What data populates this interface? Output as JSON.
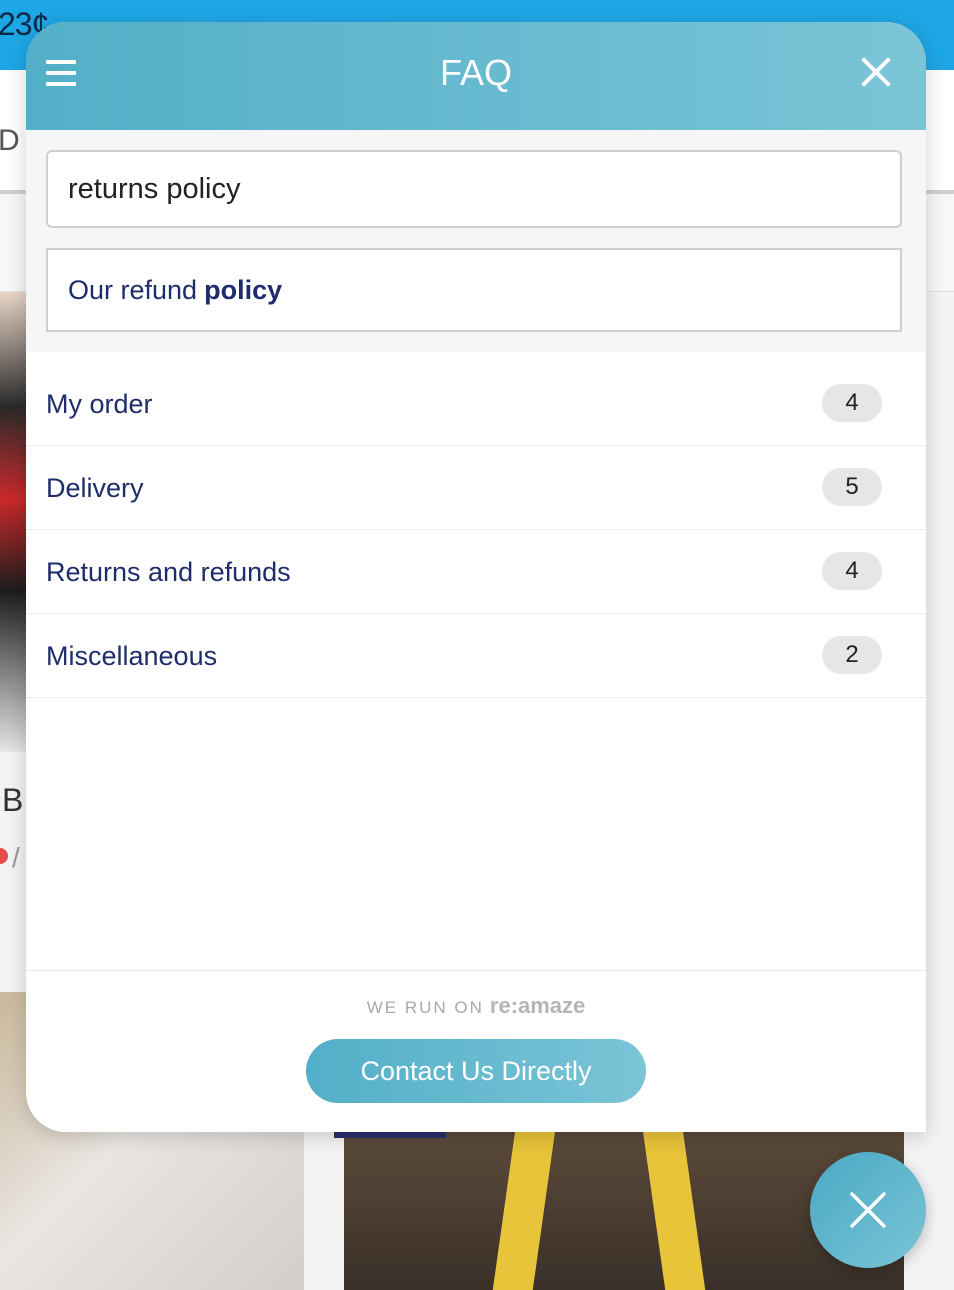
{
  "background": {
    "topbar_text": "23¢",
    "nav_letter": "D",
    "side_letter": "B",
    "side_symbol": "/"
  },
  "widget": {
    "header": {
      "title": "FAQ",
      "menu_icon": "hamburger-menu-icon",
      "close_icon": "close-icon"
    },
    "search": {
      "value": "returns policy",
      "suggestion_prefix": "Our refund",
      "suggestion_highlight": "policy"
    },
    "categories": [
      {
        "label": "My order",
        "count": "4"
      },
      {
        "label": "Delivery",
        "count": "5"
      },
      {
        "label": "Returns and refunds",
        "count": "4"
      },
      {
        "label": "Miscellaneous",
        "count": "2"
      }
    ],
    "footer": {
      "powered_text": "WE RUN ON",
      "brand": "re:amaze",
      "contact_label": "Contact Us Directly"
    }
  },
  "launcher": {
    "icon": "close-icon"
  },
  "colors": {
    "accent": "#53afc8",
    "accent_light": "#7ac4d6",
    "text_navy": "#1f2d6b",
    "badge_bg": "#e6e6e6"
  }
}
